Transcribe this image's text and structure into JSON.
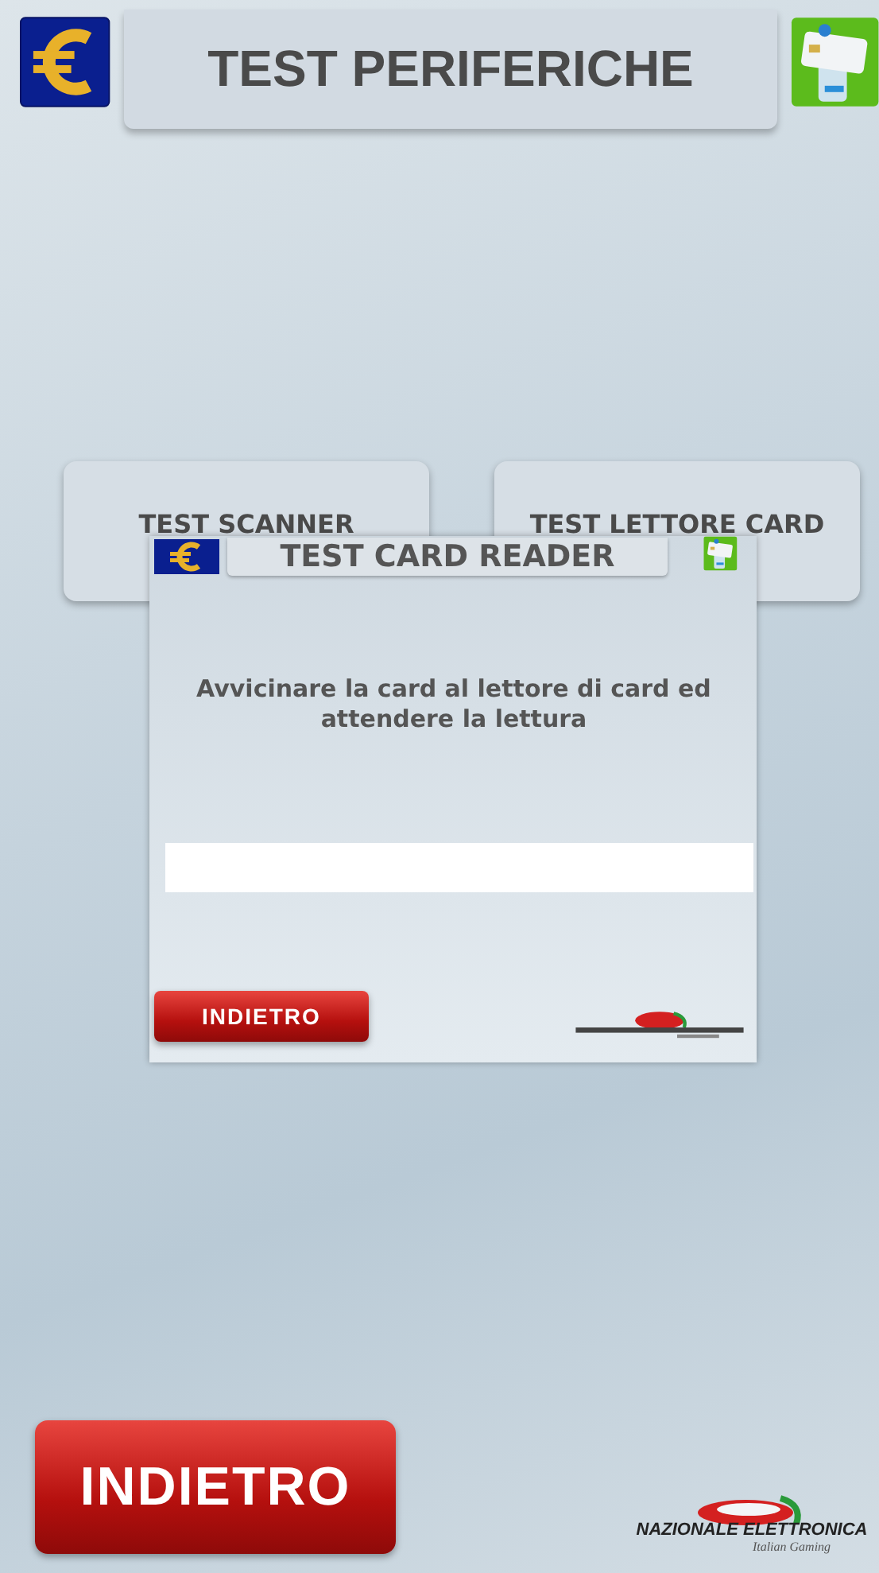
{
  "header": {
    "title": "TEST PERIFERICHE"
  },
  "menu_buttons": [
    {
      "label": "TEST SCANNER"
    },
    {
      "label": "TEST LETTORE CARD"
    }
  ],
  "dialog": {
    "title": "TEST CARD READER",
    "message": "Avvicinare la card al lettore di card ed attendere la lettura",
    "back_button": "INDIETRO"
  },
  "back_button": "INDIETRO",
  "logo": {
    "name": "NAZIONALE ELETTRONICA",
    "tagline": "Italian Gaming"
  }
}
